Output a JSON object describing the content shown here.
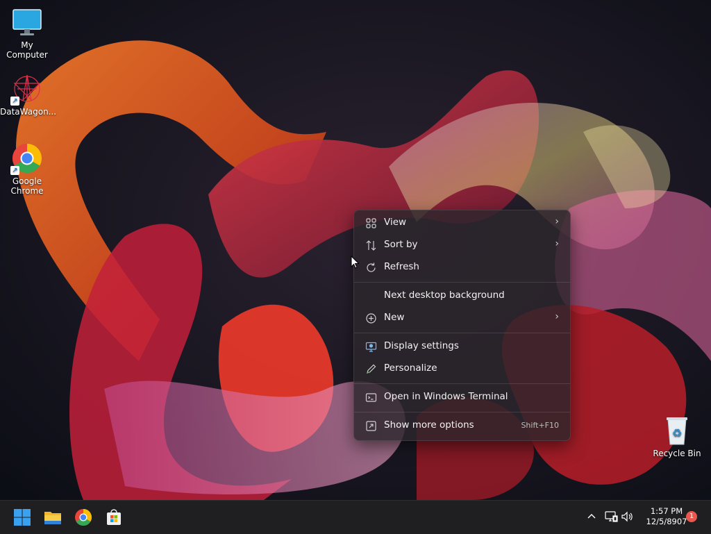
{
  "desktop": {
    "icons": [
      {
        "label": "My Computer"
      },
      {
        "label": "DataWagon..."
      },
      {
        "label": "Google\nChrome"
      },
      {
        "label": "Recycle Bin"
      }
    ]
  },
  "context_menu": {
    "items": [
      {
        "label": "View",
        "icon": "grid-icon",
        "submenu": true
      },
      {
        "label": "Sort by",
        "icon": "sort-icon",
        "submenu": true
      },
      {
        "label": "Refresh",
        "icon": "refresh-icon",
        "submenu": false
      },
      {
        "label": "Next desktop background",
        "icon": "",
        "submenu": false
      },
      {
        "label": "New",
        "icon": "plus-circle-icon",
        "submenu": true
      },
      {
        "label": "Display settings",
        "icon": "display-icon",
        "submenu": false
      },
      {
        "label": "Personalize",
        "icon": "pen-icon",
        "submenu": false
      },
      {
        "label": "Open in Windows Terminal",
        "icon": "terminal-icon",
        "submenu": false
      },
      {
        "label": "Show more options",
        "icon": "more-options-icon",
        "submenu": false,
        "shortcut": "Shift+F10"
      }
    ]
  },
  "taskbar": {
    "pinned": [
      "start-icon",
      "file-explorer-icon",
      "chrome-icon",
      "store-icon"
    ],
    "tray": [
      "chevron-up-icon",
      "network-icon",
      "volume-icon"
    ],
    "clock": {
      "time": "1:57 PM",
      "date": "12/5/8907"
    },
    "notification_count": "1"
  },
  "colors": {
    "accent": "#0078d4",
    "menu_bg": "#2c262c",
    "taskbar_bg": "#1f1f22"
  }
}
